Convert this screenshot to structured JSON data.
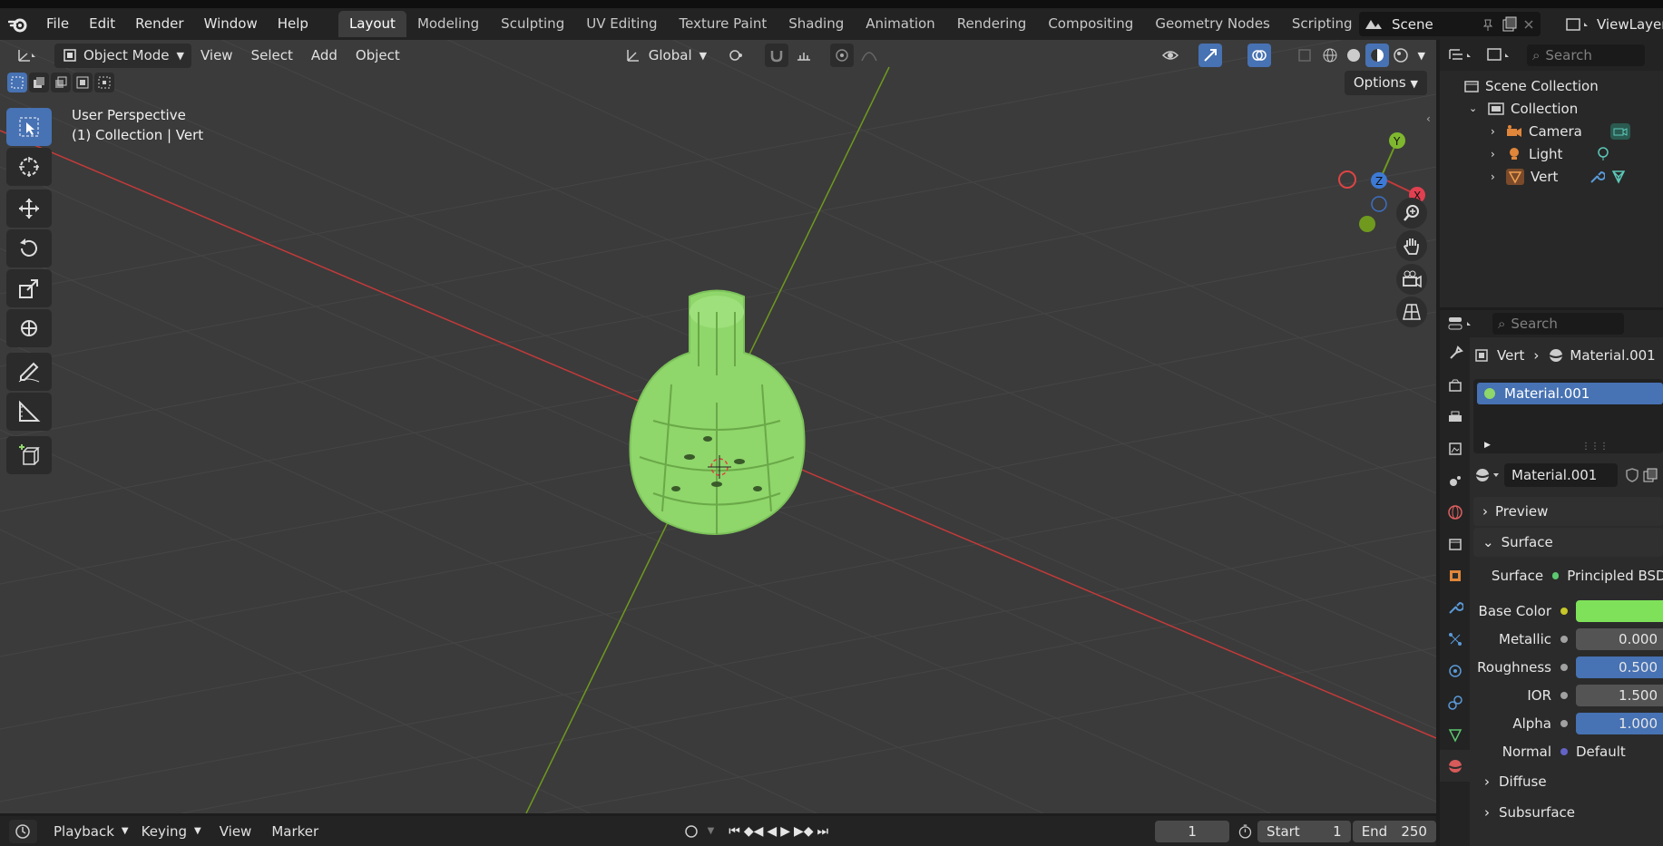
{
  "topbar": {
    "menus": [
      "File",
      "Edit",
      "Render",
      "Window",
      "Help"
    ],
    "workspaces": [
      "Layout",
      "Modeling",
      "Sculpting",
      "UV Editing",
      "Texture Paint",
      "Shading",
      "Animation",
      "Rendering",
      "Compositing",
      "Geometry Nodes",
      "Scripting"
    ],
    "active_workspace": "Layout",
    "add_workspace": "+",
    "scene": "Scene",
    "view_layer": "ViewLayer"
  },
  "viewport": {
    "mode": "Object Mode",
    "menus": [
      "View",
      "Select",
      "Add",
      "Object"
    ],
    "orientation": "Global",
    "options": "Options",
    "info_line1": "User Perspective",
    "info_line2": "(1) Collection | Vert",
    "gizmo": {
      "x": "X",
      "y": "Y",
      "z": "Z"
    },
    "colors": {
      "background": "#3b3b3b",
      "x_axis": "#c33a3a",
      "y_axis": "#6f9a1e",
      "mesh": "#8fd66b",
      "accent": "#4772b3"
    }
  },
  "timeline": {
    "menus": [
      "Playback",
      "Keying",
      "View",
      "Marker"
    ],
    "current_frame": "1",
    "start_label": "Start",
    "start": "1",
    "end_label": "End",
    "end": "250"
  },
  "outliner": {
    "search_placeholder": "Search",
    "scene_collection": "Scene Collection",
    "collection": "Collection",
    "items": [
      "Camera",
      "Light",
      "Vert"
    ]
  },
  "properties": {
    "search_placeholder": "Search",
    "breadcrumb_object": "Vert",
    "breadcrumb_material": "Material.001",
    "slot": "Material.001",
    "material_name": "Material.001",
    "panels": {
      "preview": "Preview",
      "surface": "Surface",
      "diffuse": "Diffuse",
      "subsurface": "Subsurface"
    },
    "surface_label": "Surface",
    "surface_value": "Principled BSDF",
    "rows": [
      {
        "label": "Base Color",
        "value": ""
      },
      {
        "label": "Metallic",
        "value": "0.000"
      },
      {
        "label": "Roughness",
        "value": "0.500"
      },
      {
        "label": "IOR",
        "value": "1.500"
      },
      {
        "label": "Alpha",
        "value": "1.000"
      },
      {
        "label": "Normal",
        "value": "Default"
      }
    ],
    "base_color": "#7fe15a"
  }
}
